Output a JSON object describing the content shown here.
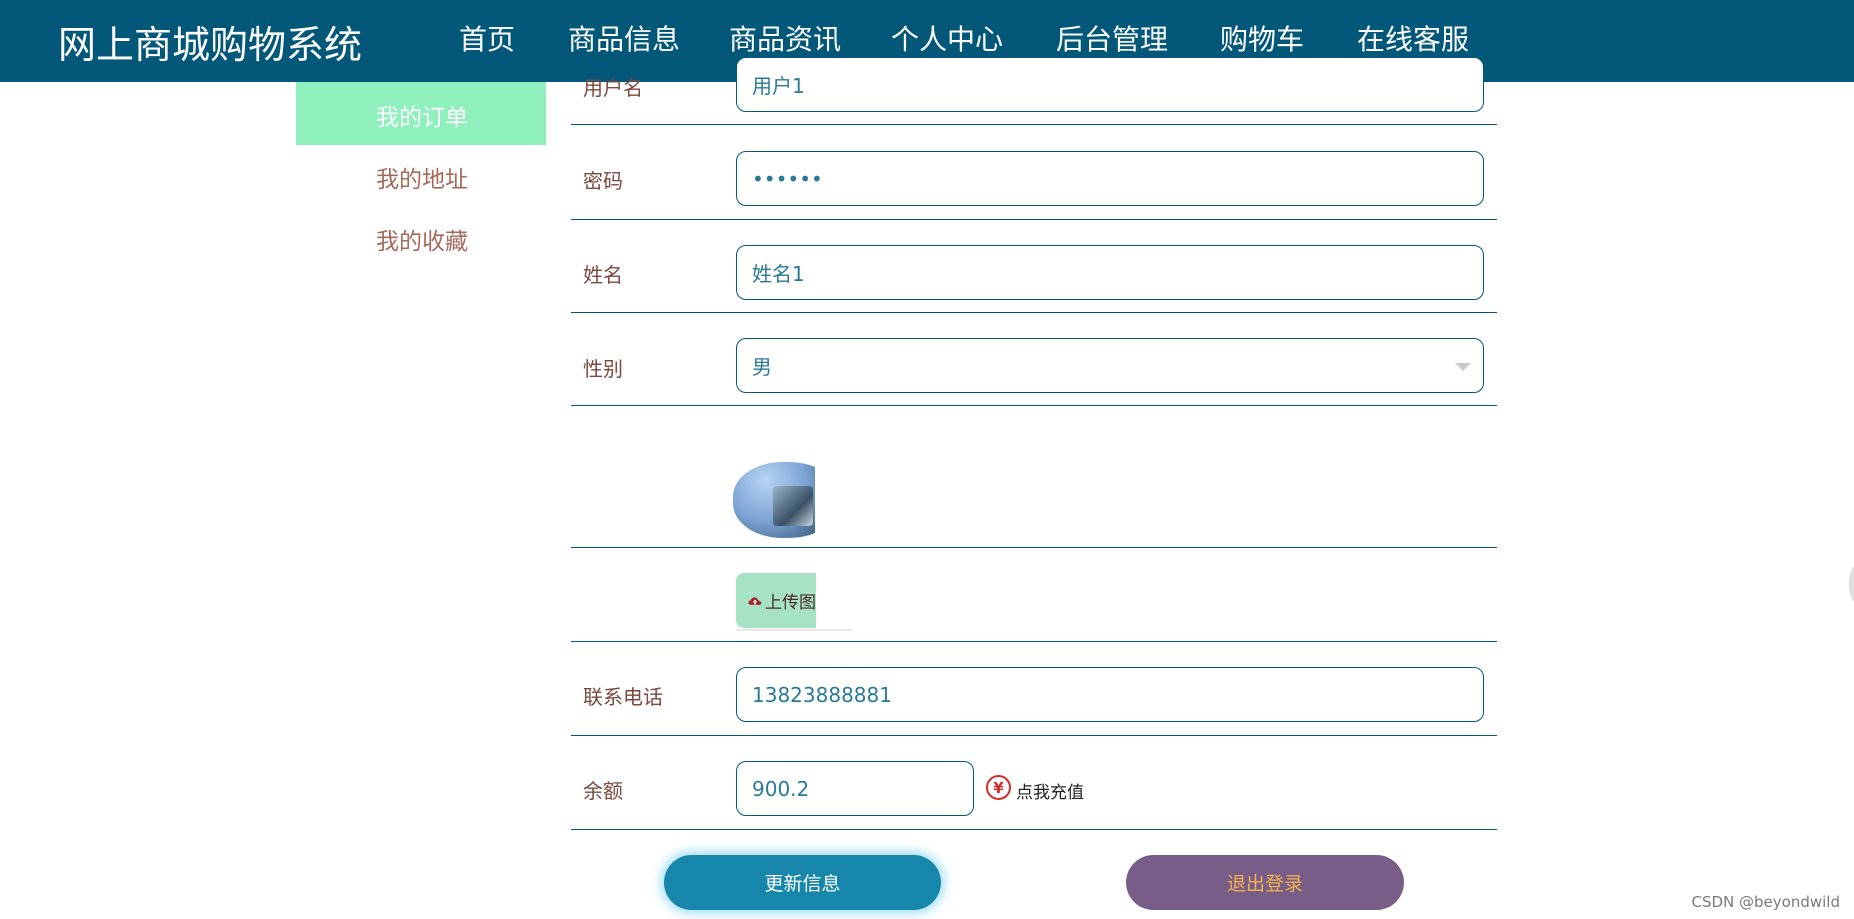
{
  "header": {
    "brand": "网上商城购物系统",
    "nav": [
      "首页",
      "商品信息",
      "商品资讯",
      "个人中心",
      "后台管理",
      "购物车",
      "在线客服"
    ],
    "active_nav": "个人中心"
  },
  "sidebar": {
    "items": [
      {
        "label": "我的订单",
        "active": true
      },
      {
        "label": "我的地址",
        "active": false
      },
      {
        "label": "我的收藏",
        "active": false
      }
    ]
  },
  "form": {
    "username": {
      "label": "用户名",
      "value": "用户1"
    },
    "password": {
      "label": "密码",
      "value": "••••••"
    },
    "name": {
      "label": "姓名",
      "value": "姓名1"
    },
    "gender": {
      "label": "性别",
      "value": "男"
    },
    "upload_label": "上传图",
    "phone": {
      "label": "联系电话",
      "value": "13823888881"
    },
    "balance": {
      "label": "余额",
      "value": "900.2"
    },
    "recharge_symbol": "¥",
    "recharge_text": "点我充值"
  },
  "buttons": {
    "update": "更新信息",
    "logout": "退出登录"
  },
  "watermark": "CSDN @beyondwild",
  "colors": {
    "header_bg": "#03587a",
    "sidebar_active_bg": "#8fefbd",
    "update_btn": "#1786ab",
    "logout_btn": "#775d87",
    "logout_text": "#f3b24a"
  }
}
